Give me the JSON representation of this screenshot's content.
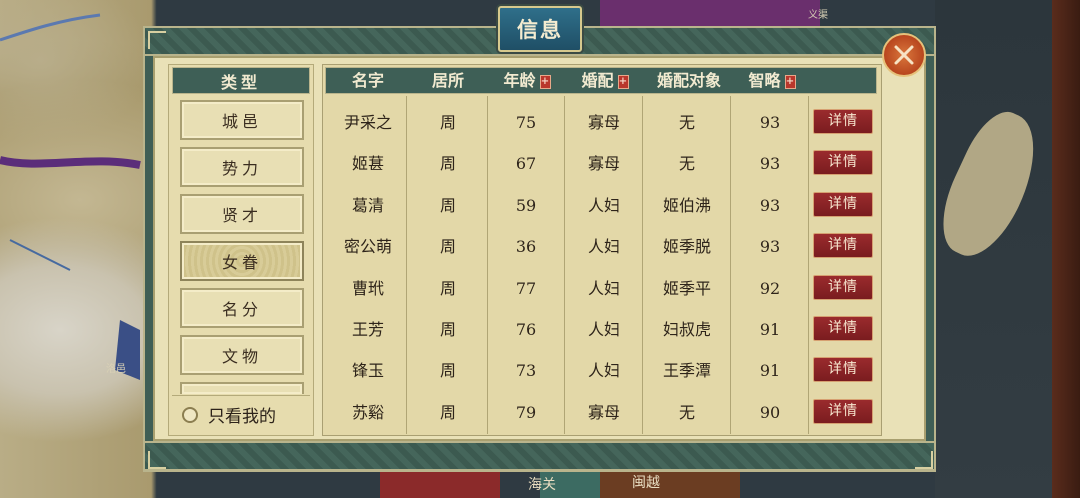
{
  "dialog": {
    "title": "信息"
  },
  "categories": {
    "header": "类型",
    "items": [
      "城邑",
      "势力",
      "贤才",
      "女眷",
      "名分",
      "文物"
    ],
    "active_index": 3,
    "only_mine_label": "只看我的"
  },
  "table": {
    "headers": {
      "name": "名字",
      "residence": "居所",
      "age": "年龄",
      "marriage": "婚配",
      "spouse": "婚配对象",
      "intellect": "智略"
    },
    "sort_mark": "+",
    "detail_label": "详情",
    "rows": [
      {
        "name": "尹采之",
        "residence": "周",
        "age": "75",
        "marriage": "寡母",
        "spouse": "无",
        "intellect": "93"
      },
      {
        "name": "姬葚",
        "residence": "周",
        "age": "67",
        "marriage": "寡母",
        "spouse": "无",
        "intellect": "93"
      },
      {
        "name": "葛清",
        "residence": "周",
        "age": "59",
        "marriage": "人妇",
        "spouse": "姬伯沸",
        "intellect": "93"
      },
      {
        "name": "密公萌",
        "residence": "周",
        "age": "36",
        "marriage": "人妇",
        "spouse": "姬季脱",
        "intellect": "93"
      },
      {
        "name": "曹玳",
        "residence": "周",
        "age": "77",
        "marriage": "人妇",
        "spouse": "姬季平",
        "intellect": "92"
      },
      {
        "name": "王芳",
        "residence": "周",
        "age": "76",
        "marriage": "人妇",
        "spouse": "妇叔虎",
        "intellect": "91"
      },
      {
        "name": "锋玉",
        "residence": "周",
        "age": "73",
        "marriage": "人妇",
        "spouse": "王季潭",
        "intellect": "91"
      },
      {
        "name": "苏谿",
        "residence": "周",
        "age": "79",
        "marriage": "寡母",
        "spouse": "无",
        "intellect": "90"
      }
    ]
  },
  "map_labels": {
    "top_right": "义渠",
    "left": "洛邑",
    "bottom_center": "海关",
    "bottom_right": "闽越"
  },
  "colors": {
    "panel_green": "#3e5f56",
    "parchment": "#e9e1b7",
    "detail_red": "#8b2426",
    "close_orange": "#c65a2a"
  }
}
